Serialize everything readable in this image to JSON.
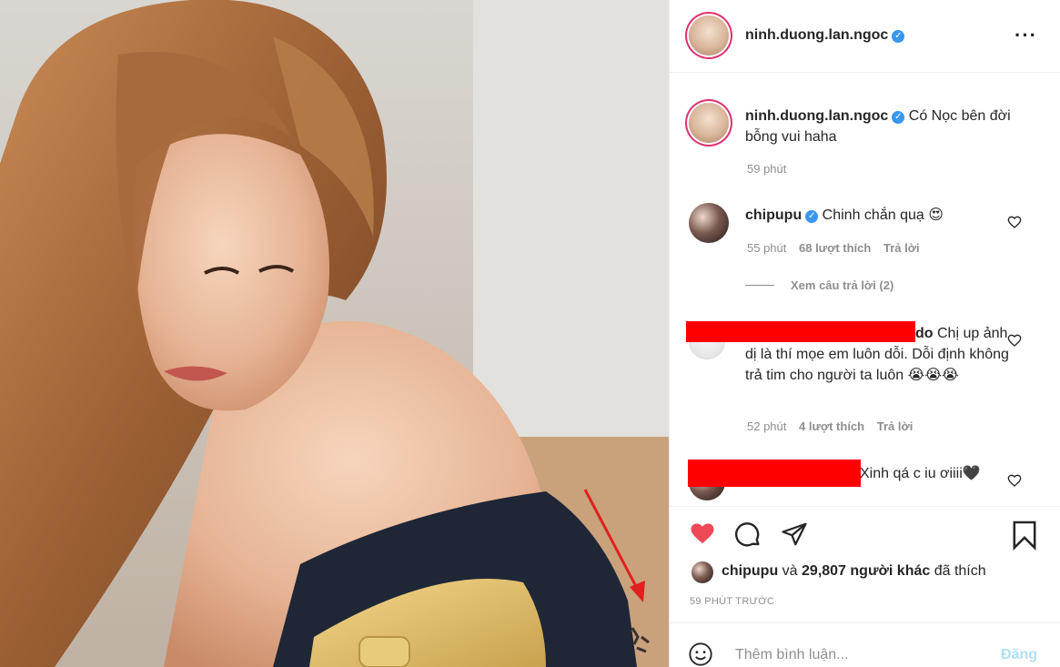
{
  "post": {
    "username": "ninh.duong.lan.ngoc",
    "caption": "Có Nọc bên đời bỗng vui haha",
    "caption_time": "59 phút",
    "more_icon": "more-horizontal-icon"
  },
  "comments": [
    {
      "username": "chipupu",
      "verified": true,
      "text": "Chinh chắn quạ 😍",
      "time": "55 phút",
      "likes": "68 lượt thích",
      "reply": "Trả lời"
    },
    {
      "username_tail": "do",
      "text": " Chị up ảnh dị là thí mọe em luôn dỗi. Dỗi định không trả tim cho người ta luôn 😭😭😭",
      "time": "52 phút",
      "likes": "4 lượt thích",
      "reply": "Trả lời"
    },
    {
      "text": "Xinh qá c iu ơiiii🖤"
    }
  ],
  "view_replies": "Xem câu trả lời (2)",
  "liked_by": {
    "user": "chipupu",
    "and": " và ",
    "others": "29,807 người khác",
    "suffix": " đã thích"
  },
  "timestamp": "59 PHÚT TRƯỚC",
  "add_comment": {
    "placeholder": "Thêm bình luận...",
    "post_label": "Đăng"
  },
  "colors": {
    "like_red": "#ed4956",
    "verified_blue": "#3897f0",
    "redaction": "#ff0000",
    "annotation_arrow": "#e02020"
  }
}
